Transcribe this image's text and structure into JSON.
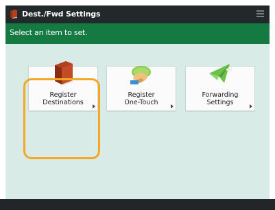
{
  "window": {
    "title": "Dest./Fwd Settings"
  },
  "instruction": {
    "text": "Select an item to set."
  },
  "tiles": [
    {
      "label": "Register\nDestinations",
      "selected": true
    },
    {
      "label": "Register\nOne-Touch",
      "selected": false
    },
    {
      "label": "Forwarding\nSettings",
      "selected": false
    }
  ],
  "colors": {
    "titlebar": "#23282b",
    "instruction_bar": "#147a41",
    "content_bg": "#d8ebe6",
    "selection": "#f5a623"
  },
  "icons": {
    "title": "address-book-icon",
    "menu": "menu-icon",
    "tile1": "address-book-icon",
    "tile2": "one-touch-hand-icon",
    "tile3": "forwarding-plane-icon"
  }
}
